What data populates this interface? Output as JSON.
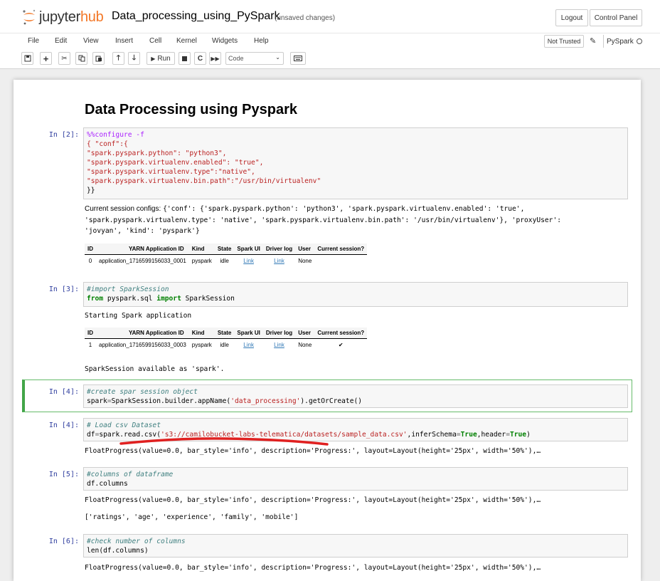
{
  "header": {
    "logo_text_1": "jupyter",
    "logo_text_2": "hub",
    "notebook_title": "Data_processing_using_PySpark",
    "save_status": "(unsaved changes)",
    "logout_label": "Logout",
    "control_panel_label": "Control Panel"
  },
  "menu": {
    "items": [
      "File",
      "Edit",
      "View",
      "Insert",
      "Cell",
      "Kernel",
      "Widgets",
      "Help"
    ],
    "not_trusted_label": "Not Trusted",
    "kernel_name": "PySpark"
  },
  "toolbar": {
    "run_label": "Run",
    "cell_type": "Code"
  },
  "notebook": {
    "heading": "Data Processing using Pyspark",
    "cells": [
      {
        "prompt": "In [2]:",
        "code_lines": [
          "%%configure -f",
          "{ \"conf\":{",
          "\"spark.pyspark.python\": \"python3\",",
          "\"spark.pyspark.virtualenv.enabled\": \"true\",",
          "\"spark.pyspark.virtualenv.type\":\"native\",",
          "\"spark.pyspark.virtualenv.bin.path\":\"/usr/bin/virtualenv\"",
          "}}"
        ],
        "output_label": "Current session configs:",
        "output_lines": [
          "{'conf': {'spark.pyspark.python': 'python3', 'spark.pyspark.virtualenv.enabled': 'true',",
          "'spark.pyspark.virtualenv.type': 'native', 'spark.pyspark.virtualenv.bin.path': '/usr/bin/virtualenv'}, 'proxyUser':",
          "'jovyan', 'kind': 'pyspark'}"
        ],
        "table": {
          "headers": [
            "ID",
            "YARN Application ID",
            "Kind",
            "State",
            "Spark UI",
            "Driver log",
            "User",
            "Current session?"
          ],
          "rows": [
            [
              "0",
              "application_1716599156033_0001",
              "pyspark",
              "idle",
              "Link",
              "Link",
              "None",
              ""
            ]
          ]
        }
      },
      {
        "prompt": "In [3]:",
        "code_lines": [
          "#import SparkSession",
          "from pyspark.sql import SparkSession"
        ],
        "output_pre": "Starting Spark application",
        "table": {
          "headers": [
            "ID",
            "YARN Application ID",
            "Kind",
            "State",
            "Spark UI",
            "Driver log",
            "User",
            "Current session?"
          ],
          "rows": [
            [
              "1",
              "application_1716599156033_0003",
              "pyspark",
              "idle",
              "Link",
              "Link",
              "None",
              "✔"
            ]
          ]
        },
        "output_post": "SparkSession available as 'spark'."
      },
      {
        "prompt": "In [4]:",
        "code_lines": [
          "#create spar session object",
          "spark=SparkSession.builder.appName('data_processing').getOrCreate()"
        ]
      },
      {
        "prompt": "In [4]:",
        "code_lines": [
          "# Load csv Dataset",
          "df=spark.read.csv('s3://camilobucket-labs-telematica/datasets/sample_data.csv',inferSchema=True,header=True)"
        ],
        "output": "FloatProgress(value=0.0, bar_style='info', description='Progress:', layout=Layout(height='25px', width='50%'),…"
      },
      {
        "prompt": "In [5]:",
        "code_lines": [
          "#columns of dataframe",
          "df.columns"
        ],
        "output": "FloatProgress(value=0.0, bar_style='info', description='Progress:', layout=Layout(height='25px', width='50%'),…",
        "output_2": "['ratings', 'age', 'experience', 'family', 'mobile']"
      },
      {
        "prompt": "In [6]:",
        "code_lines": [
          "#check number of columns",
          "len(df.columns)"
        ],
        "output": "FloatProgress(value=0.0, bar_style='info', description='Progress:', layout=Layout(height='25px', width='50%'),…"
      }
    ]
  },
  "colors": {
    "prompt": "#303f9f",
    "annotation_underline": "#e02020",
    "selected_cell_border": "#42a548",
    "logo_orange": "#f37726"
  }
}
